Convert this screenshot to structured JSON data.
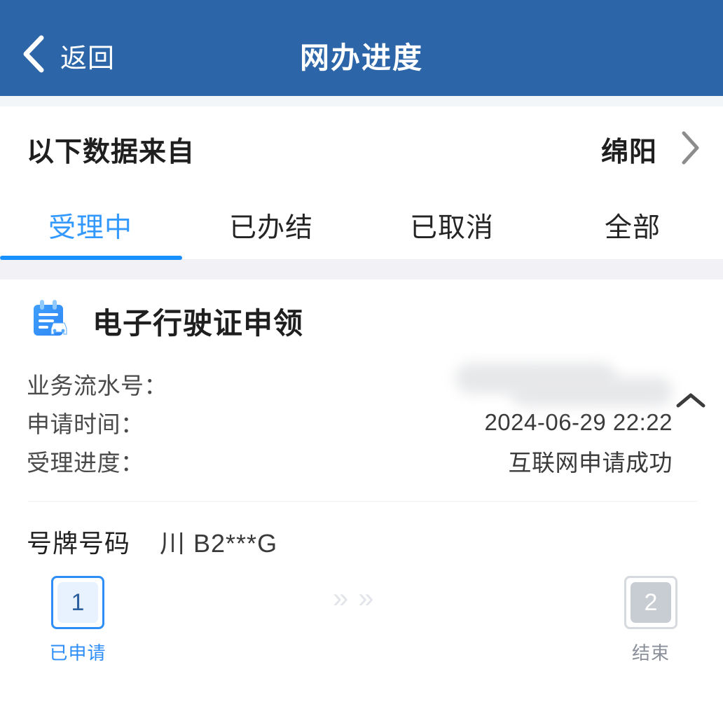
{
  "header": {
    "back_label": "返回",
    "title": "网办进度",
    "back_icon": "chevron-left-icon",
    "background_color": "#2C66A8"
  },
  "region_selector": {
    "label": "以下数据来自",
    "value": "绵阳",
    "chevron_icon": "chevron-right-icon"
  },
  "tabs": {
    "active_index": 0,
    "active_color": "#3399FF",
    "items": [
      {
        "label": "受理中"
      },
      {
        "label": "已办结"
      },
      {
        "label": "已取消"
      },
      {
        "label": "全部"
      }
    ]
  },
  "card": {
    "icon": "vehicle-license-icon",
    "title": "电子行驶证申领",
    "collapse_icon": "chevron-up-icon",
    "details": [
      {
        "label": "业务流水号：",
        "value": "",
        "redacted": true
      },
      {
        "label": "申请时间：",
        "value": "2024-06-29 22:22",
        "redacted": false
      },
      {
        "label": "受理进度：",
        "value": "互联网申请成功",
        "redacted": false
      }
    ],
    "plate": {
      "label": "号牌号码",
      "value": "川 B2***G"
    },
    "progress": {
      "arrow_glyph": "»",
      "steps": [
        {
          "number": "1",
          "label": "已申请",
          "state": "active"
        },
        {
          "number": "2",
          "label": "结束",
          "state": "inactive"
        }
      ]
    }
  }
}
